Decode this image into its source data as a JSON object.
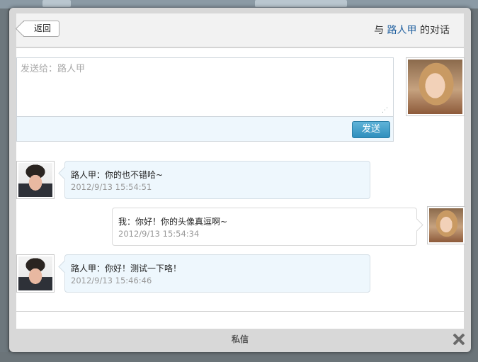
{
  "header": {
    "back_label": "返回",
    "title_prefix": "与 ",
    "title_name": "路人甲",
    "title_suffix": " 的对话"
  },
  "compose": {
    "placeholder": "发送给：路人甲",
    "value": "",
    "send_label": "发送"
  },
  "messages": [
    {
      "sender": "路人甲",
      "text": "路人甲：你的也不错哈~",
      "time": "2012/9/13 15:54:51",
      "side": "left",
      "avatar_icon": "man-avatar"
    },
    {
      "sender": "我",
      "text": "我：你好！你的头像真逗啊~",
      "time": "2012/9/13 15:54:34",
      "side": "right",
      "avatar_icon": "woman-avatar"
    },
    {
      "sender": "路人甲",
      "text": "路人甲：你好！测试一下咯！",
      "time": "2012/9/13 15:46:46",
      "side": "left",
      "avatar_icon": "man-avatar"
    }
  ],
  "footer": {
    "title": "私信",
    "close_icon": "close-icon"
  },
  "colors": {
    "accent": "#1f5f9f",
    "send_button": "#3a9ac6",
    "bubble_bg": "#eef7fd"
  }
}
